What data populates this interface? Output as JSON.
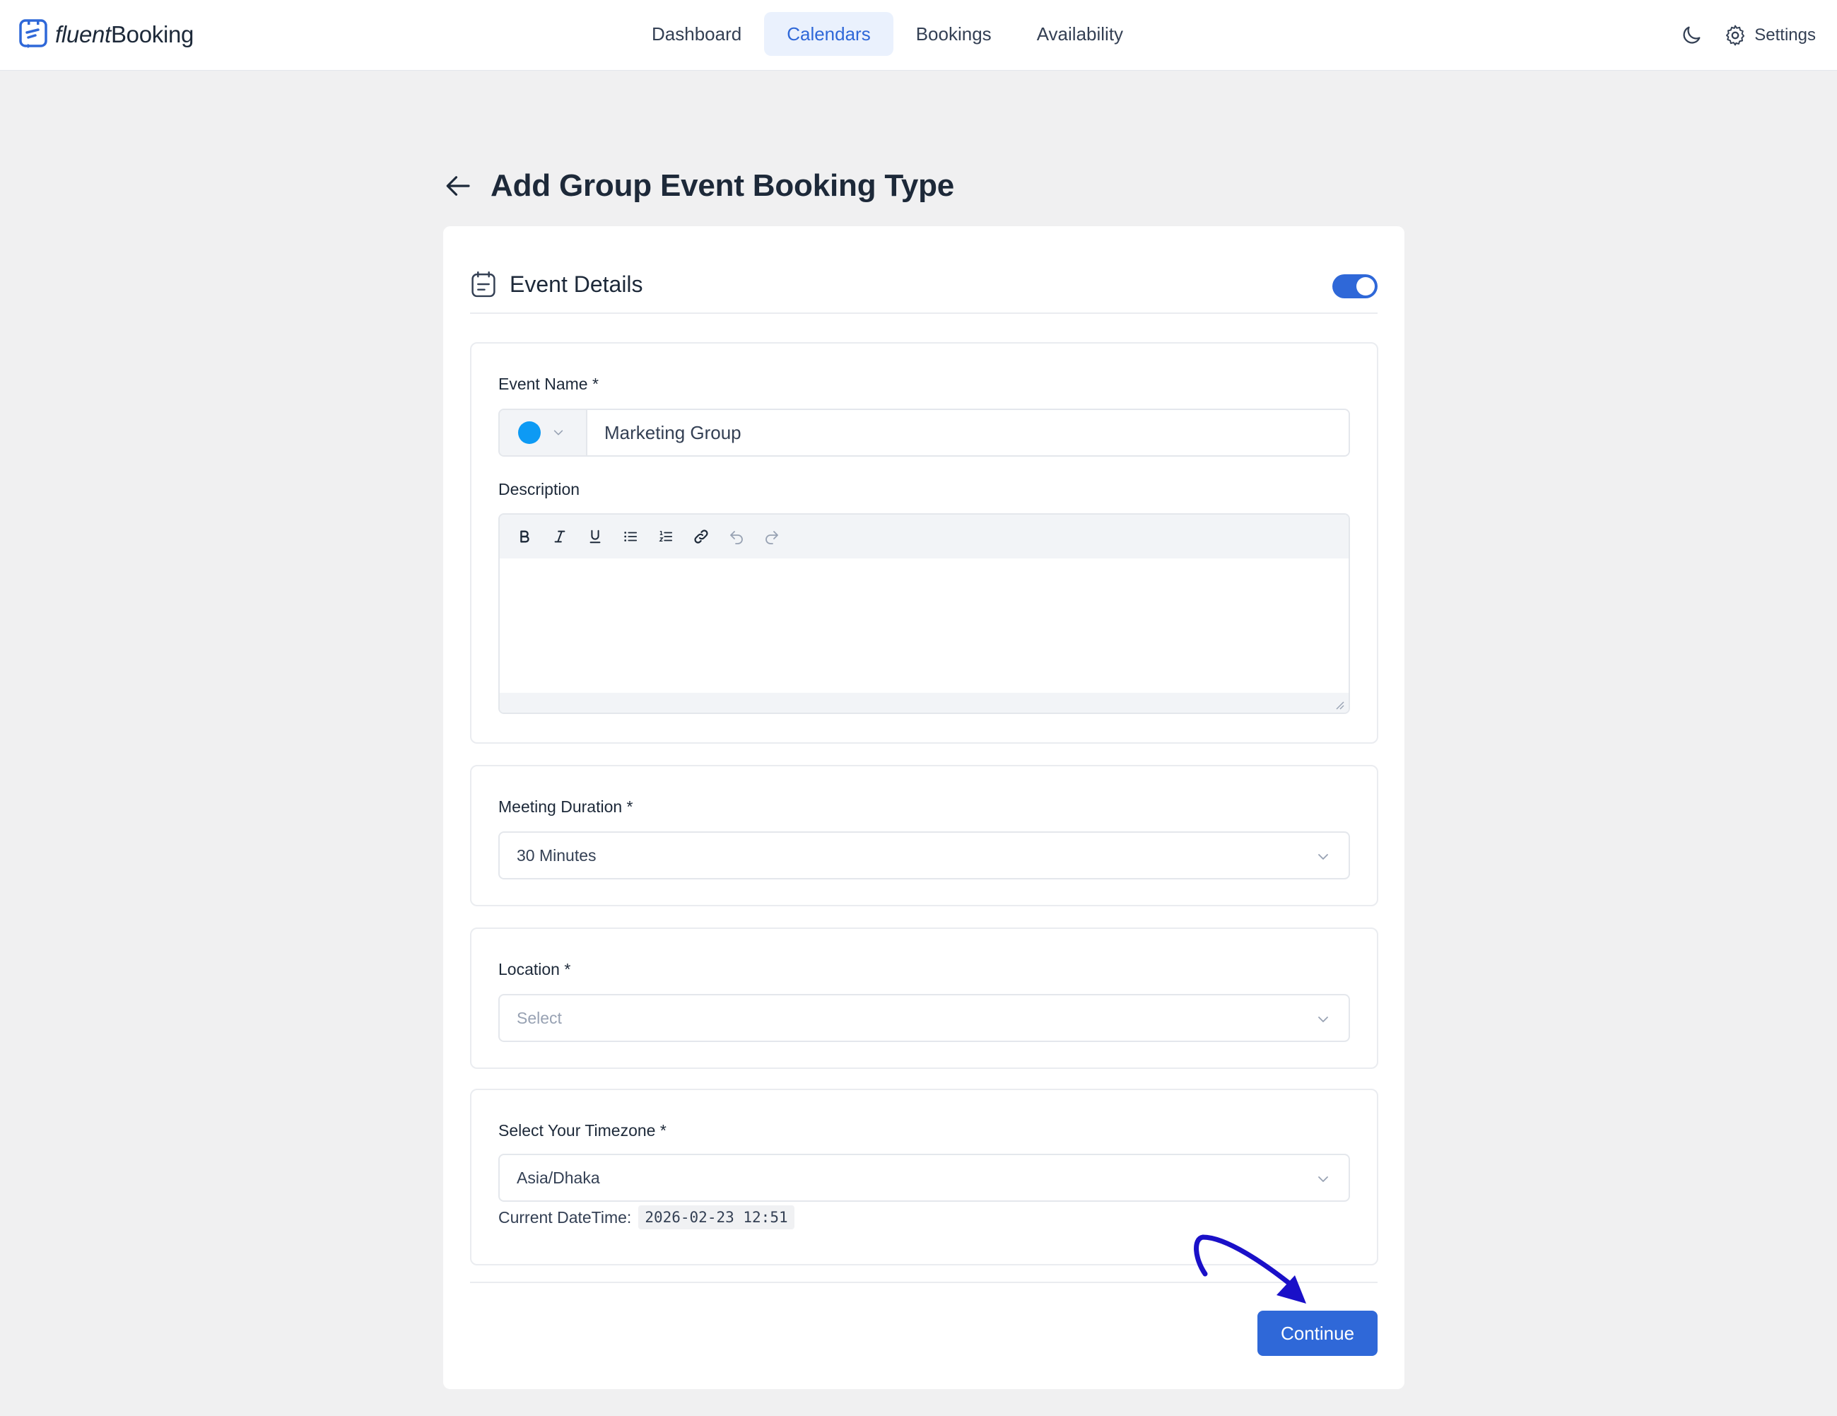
{
  "brand": {
    "name_light": "fluent",
    "name_bold": "Booking",
    "accent": "#2f68d8"
  },
  "nav": {
    "items": [
      {
        "label": "Dashboard",
        "active": false
      },
      {
        "label": "Calendars",
        "active": true
      },
      {
        "label": "Bookings",
        "active": false
      },
      {
        "label": "Availability",
        "active": false
      }
    ],
    "dark_mode_icon": "moon-icon",
    "settings_label": "Settings"
  },
  "page": {
    "title": "Add Group Event Booking Type"
  },
  "card": {
    "title": "Event Details",
    "toggle_on": true
  },
  "event_name": {
    "label": "Event Name",
    "required_mark": "*",
    "color": "#0d9af4",
    "value": "Marketing Group"
  },
  "description": {
    "label": "Description",
    "toolbar": [
      "bold",
      "italic",
      "underline",
      "bullet-list",
      "numbered-list",
      "link",
      "undo",
      "redo"
    ],
    "value": ""
  },
  "duration": {
    "label": "Meeting Duration",
    "required_mark": "*",
    "value": "30 Minutes"
  },
  "location": {
    "label": "Location",
    "required_mark": "*",
    "placeholder": "Select"
  },
  "timezone": {
    "label": "Select Your Timezone",
    "required_mark": "*",
    "value": "Asia/Dhaka",
    "current_label": "Current DateTime:",
    "current_value": "2026-02-23 12:51"
  },
  "actions": {
    "continue_label": "Continue"
  }
}
